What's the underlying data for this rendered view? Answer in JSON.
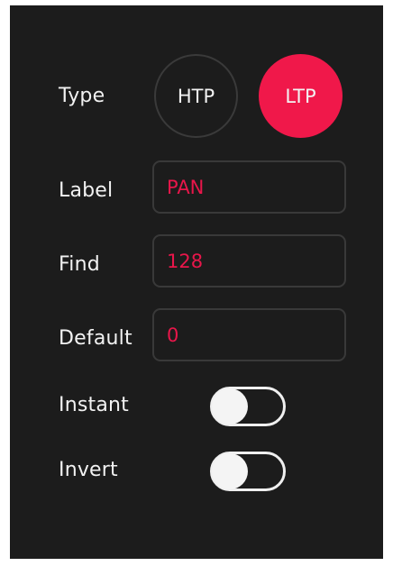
{
  "type": {
    "label": "Type",
    "options": [
      "HTP",
      "LTP"
    ],
    "selected": "LTP"
  },
  "fields": {
    "label": {
      "label": "Label",
      "value": "PAN"
    },
    "find": {
      "label": "Find",
      "value": "128"
    },
    "default": {
      "label": "Default",
      "value": "0"
    }
  },
  "toggles": {
    "instant": {
      "label": "Instant",
      "on": false
    },
    "invert": {
      "label": "Invert",
      "on": false
    }
  },
  "colors": {
    "background": "#1c1c1c",
    "accent": "#f0184a",
    "text": "#f2f2f2",
    "field_border": "#393939"
  }
}
